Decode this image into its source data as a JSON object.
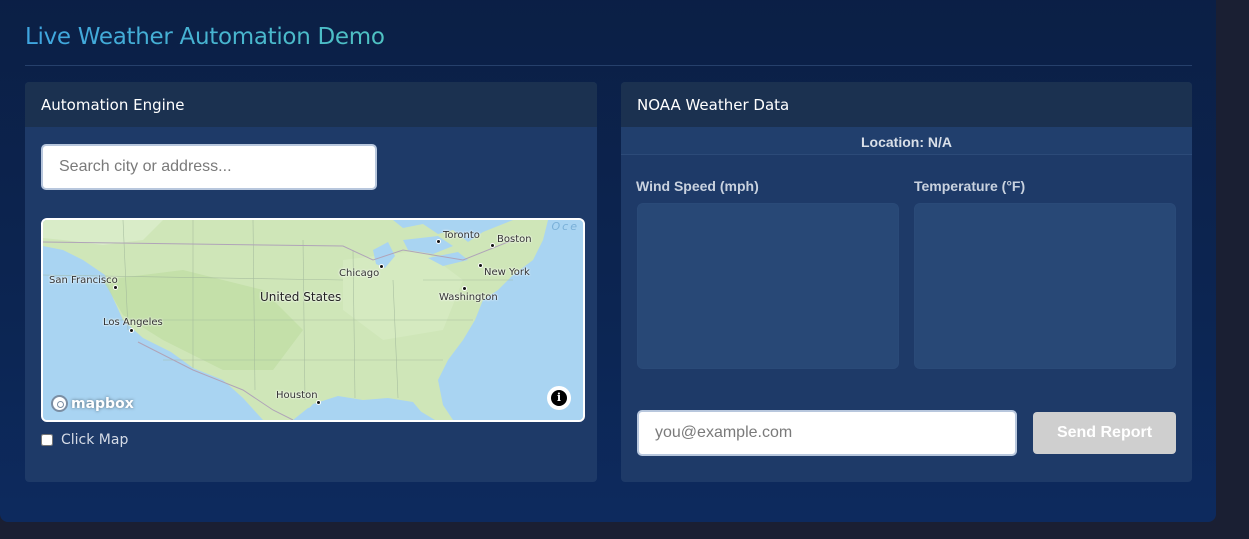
{
  "app": {
    "title": "Live Weather Automation Demo"
  },
  "automation_panel": {
    "title": "Automation Engine",
    "search_placeholder": "Search city or address...",
    "click_map_label": "Click Map",
    "click_map_checked": false,
    "map": {
      "ocean_label": "Oce",
      "country_label": "United States",
      "cities": [
        {
          "name": "San Francisco"
        },
        {
          "name": "Los Angeles"
        },
        {
          "name": "Chicago"
        },
        {
          "name": "Toronto"
        },
        {
          "name": "Boston"
        },
        {
          "name": "New York"
        },
        {
          "name": "Washington"
        },
        {
          "name": "Houston"
        }
      ],
      "attribution_logo": "mapbox",
      "info_icon": "i"
    }
  },
  "weather_panel": {
    "title": "NOAA Weather Data",
    "location_text": "Location: N/A",
    "wind_label": "Wind Speed (mph)",
    "temp_label": "Temperature (°F)",
    "email_placeholder": "you@example.com",
    "send_label": "Send Report"
  },
  "colors": {
    "background": "#1a1f33",
    "panel": "#1e3a68",
    "title_gradient_start": "#3fa5e0",
    "title_gradient_end": "#4fc2c2",
    "send_button_disabled": "#cfcfcf"
  }
}
